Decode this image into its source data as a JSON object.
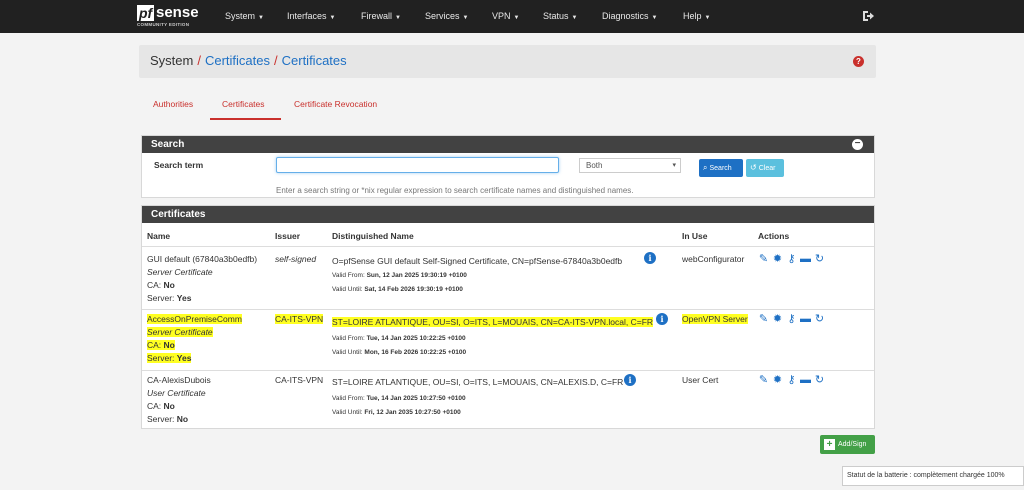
{
  "nav": {
    "logo_pf": "pf",
    "logo_sense": "sense",
    "logo_edition": "COMMUNITY EDITION",
    "items": [
      "System",
      "Interfaces",
      "Firewall",
      "Services",
      "VPN",
      "Status",
      "Diagnostics",
      "Help"
    ]
  },
  "breadcrumb": {
    "system": "System",
    "sep": "/",
    "certs1": "Certificates",
    "certs2": "Certificates"
  },
  "tabs": [
    "Authorities",
    "Certificates",
    "Certificate Revocation"
  ],
  "search": {
    "heading": "Search",
    "label": "Search term",
    "input_value": "",
    "select_value": "Both",
    "search_btn": "Search",
    "clear_btn": "Clear",
    "help": "Enter a search string or *nix regular expression to search certificate names and distinguished names."
  },
  "certs": {
    "heading": "Certificates",
    "columns": [
      "Name",
      "Issuer",
      "Distinguished Name",
      "In Use",
      "Actions"
    ],
    "rows": [
      {
        "name": "GUI default (67840a3b0edfb)",
        "type": "Server Certificate",
        "ca_label": "CA:",
        "ca_value": "No",
        "server_label": "Server:",
        "server_value": "Yes",
        "issuer": "self-signed",
        "dn": "O=pfSense GUI default Self-Signed Certificate, CN=pfSense-67840a3b0edfb",
        "valid_from_label": "Valid From:",
        "valid_from": "Sun, 12 Jan 2025 19:30:19 +0100",
        "valid_until_label": "Valid Until:",
        "valid_until": "Sat, 14 Feb 2026 19:30:19 +0100",
        "in_use": "webConfigurator"
      },
      {
        "name": "AccessOnPremiseComm",
        "type": "Server Certificate",
        "ca_label": "CA:",
        "ca_value": "No",
        "server_label": "Server:",
        "server_value": "Yes",
        "issuer": "CA-ITS-VPN",
        "dn": "ST=LOIRE ATLANTIQUE, OU=SI, O=ITS, L=MOUAIS, CN=CA-ITS-VPN.local, C=FR",
        "valid_from_label": "Valid From:",
        "valid_from": "Tue, 14 Jan 2025 10:22:25 +0100",
        "valid_until_label": "Valid Until:",
        "valid_until": "Mon, 16 Feb 2026 10:22:25 +0100",
        "in_use": "OpenVPN Server"
      },
      {
        "name": "CA-AlexisDubois",
        "type": "User Certificate",
        "ca_label": "CA:",
        "ca_value": "No",
        "server_label": "Server:",
        "server_value": "No",
        "issuer": "CA-ITS-VPN",
        "dn": "ST=LOIRE ATLANTIQUE, OU=SI, O=ITS, L=MOUAIS, CN=ALEXIS.D, C=FR",
        "valid_from_label": "Valid From:",
        "valid_from": "Tue, 14 Jan 2025 10:27:50 +0100",
        "valid_until_label": "Valid Until:",
        "valid_until": "Fri, 12 Jan 2035 10:27:50 +0100",
        "in_use": "User Cert"
      }
    ]
  },
  "add_btn": "Add/Sign",
  "battery": "Statut de la batterie : complètement chargée 100%",
  "colors": {
    "accent_red": "#c9302c",
    "link_blue": "#1e70c4",
    "navbar": "#212121",
    "panel_heading": "#424242",
    "highlight": "#ffff22",
    "add_green": "#43a047"
  }
}
